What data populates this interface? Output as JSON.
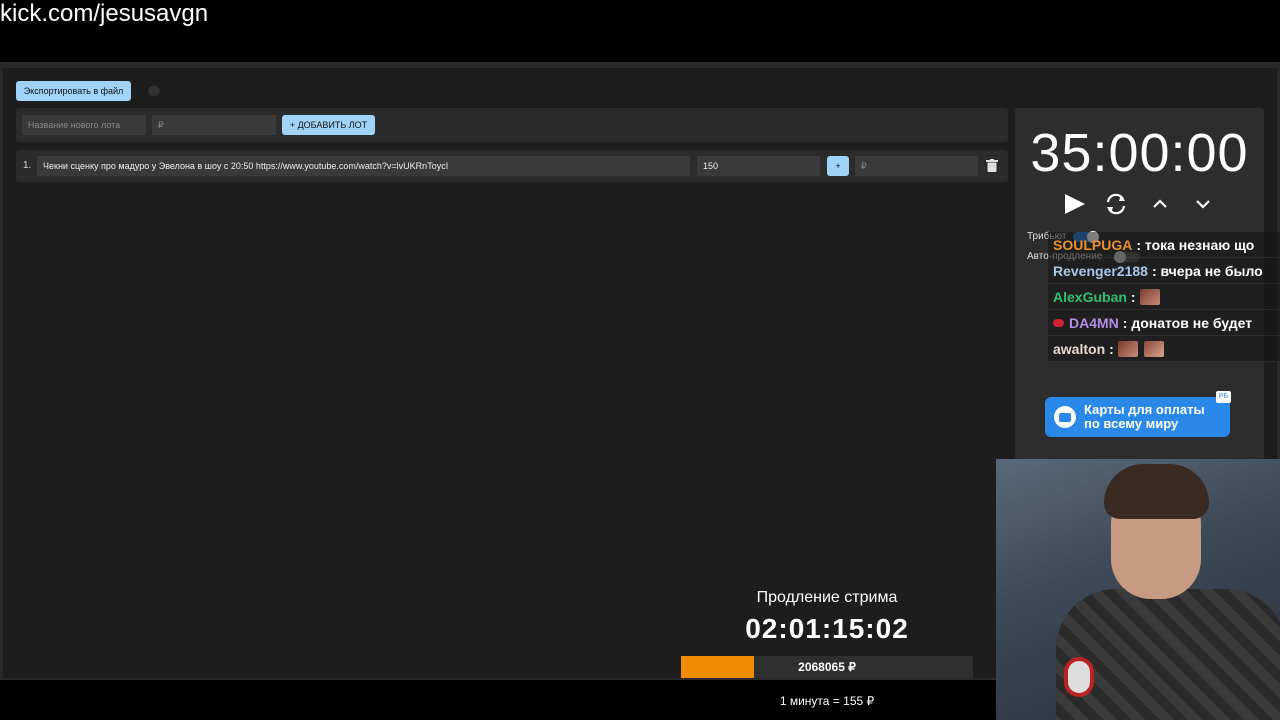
{
  "page": {
    "url_overlay": "kick.com/jesusavgn"
  },
  "toolbar": {
    "export_label": "Экспортировать в файл"
  },
  "add_lot": {
    "name_placeholder": "Название нового лота",
    "amount_placeholder": "₽",
    "add_label": "+ ДОБАВИТЬ ЛОТ"
  },
  "lots": [
    {
      "number": "1.",
      "name": "Чекни сценку про мадуро у Эвелона в шоу с 20:50 https://www.youtube.com/watch?v=lvUKRnToycI",
      "amount": "150",
      "plus_label": "+",
      "add_amount_placeholder": "₽"
    }
  ],
  "timer": {
    "value": "35:00:00",
    "tribute_label": "Трибьют",
    "auto_extend_label": "Авто-продление",
    "tribute_on": true,
    "auto_extend_on": false
  },
  "chat": [
    {
      "user": "SOULPUGA",
      "color": "#e8922b",
      "text": ": тока незнаю що",
      "emotes": 0,
      "badge": false
    },
    {
      "user": "Revenger2188",
      "color": "#a9c6e8",
      "text": ": вчера не было",
      "emotes": 0,
      "badge": false
    },
    {
      "user": "AlexGuban",
      "color": "#2fbf71",
      "text": ":",
      "emotes": 1,
      "badge": false
    },
    {
      "user": "DA4MN",
      "color": "#b48de8",
      "text": ": донатов не будет",
      "emotes": 0,
      "badge": true
    },
    {
      "user": "awalton",
      "color": "#e8d8d0",
      "text": ":",
      "emotes": 2,
      "badge": false
    }
  ],
  "ad": {
    "line1": "Карты для оплаты",
    "line2": "по всему миру",
    "badge": "РБ"
  },
  "extension": {
    "title": "Продление стрима",
    "timer": "02:01:15:02",
    "amount": "2068065 ₽",
    "progress_fraction": 0.25,
    "rate": "1 минута = 155 ₽"
  }
}
